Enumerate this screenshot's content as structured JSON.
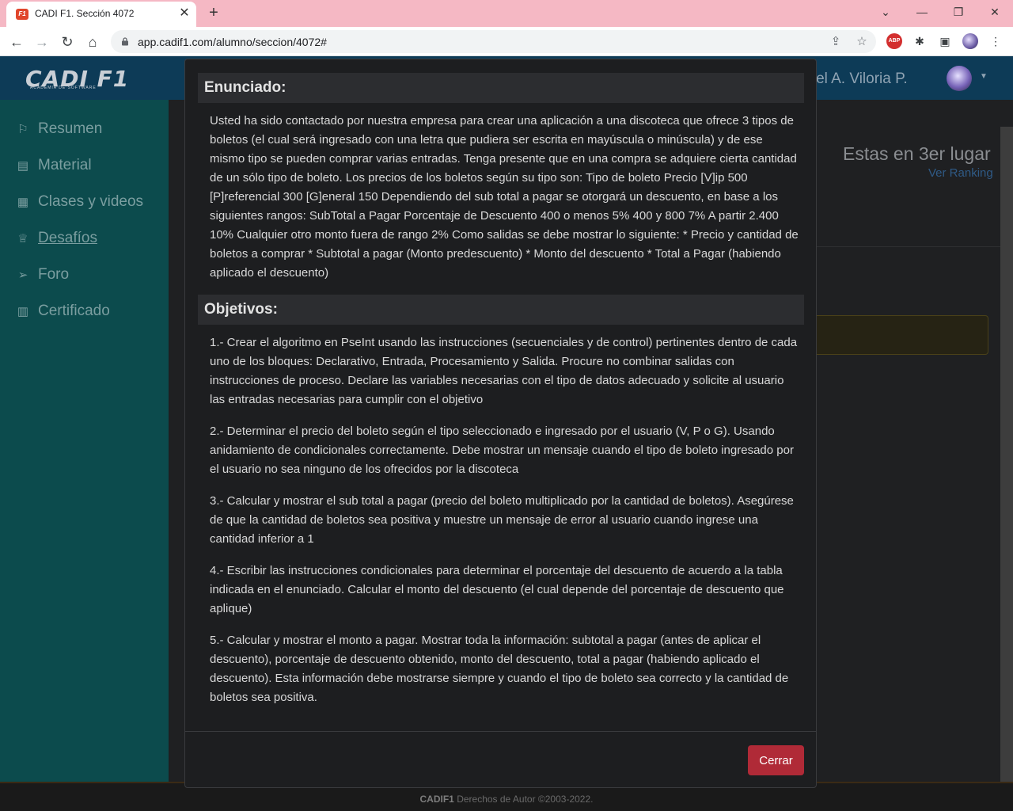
{
  "browser": {
    "tab_title": "CADI F1. Sección 4072",
    "tab_favicon_text": "F1",
    "url": "app.cadif1.com/alumno/seccion/4072#",
    "abp_label": "ABP"
  },
  "header": {
    "logo_text": "CADI F1",
    "logo_subtitle": "ACADEMIA DE SOFTWARE",
    "user_name": "briel A. Viloria P."
  },
  "sidebar": {
    "items": [
      {
        "label": "Resumen",
        "icon": "flag-icon"
      },
      {
        "label": "Material",
        "icon": "book-icon"
      },
      {
        "label": "Clases y videos",
        "icon": "calendar-icon"
      },
      {
        "label": "Desafíos",
        "icon": "trophy-icon"
      },
      {
        "label": "Foro",
        "icon": "send-icon"
      },
      {
        "label": "Certificado",
        "icon": "certificate-icon"
      }
    ]
  },
  "content": {
    "rank_text": "Estas en 3er lugar",
    "rank_link": "Ver Ranking"
  },
  "footer": {
    "brand": "CADIF1",
    "text": "Derechos de Autor ©2003-2022."
  },
  "modal": {
    "statement_heading": "Enunciado:",
    "statement": "Usted ha sido contactado por nuestra empresa para crear una aplicación a una discoteca que ofrece 3 tipos de boletos (el cual será ingresado con una letra que pudiera ser escrita en mayúscula o minúscula) y de ese mismo tipo se pueden comprar varias entradas. Tenga presente que en una compra se adquiere cierta cantidad de un sólo tipo de boleto. Los precios de los boletos según su tipo son: Tipo de boleto Precio [V]ip 500 [P]referencial 300 [G]eneral 150 Dependiendo del sub total a pagar se otorgará un descuento, en base a los siguientes rangos: SubTotal a Pagar Porcentaje de Descuento 400 o menos 5% 400 y 800 7% A partir 2.400 10% Cualquier otro monto fuera de rango 2% Como salidas se debe mostrar lo siguiente: * Precio y cantidad de boletos a comprar * Subtotal a pagar (Monto predescuento) * Monto del descuento * Total a Pagar (habiendo aplicado el descuento)",
    "objectives_heading": "Objetivos:",
    "objectives": [
      "1.- Crear el algoritmo en PseInt usando las instrucciones (secuenciales y de control) pertinentes dentro de cada uno de los bloques: Declarativo, Entrada, Procesamiento y Salida. Procure no combinar salidas con instrucciones de proceso. Declare las variables necesarias con el tipo de datos adecuado y solicite al usuario las entradas necesarias para cumplir con el objetivo",
      "2.- Determinar el precio del boleto según el tipo seleccionado e ingresado por el usuario (V, P o G). Usando anidamiento de condicionales correctamente. Debe mostrar un mensaje cuando el tipo de boleto ingresado por el usuario no sea ninguno de los ofrecidos por la discoteca",
      "3.- Calcular y mostrar el sub total a pagar (precio del boleto multiplicado por la cantidad de boletos). Asegúrese de que la cantidad de boletos sea positiva y muestre un mensaje de error al usuario cuando ingrese una cantidad inferior a 1",
      "4.- Escribir las instrucciones condicionales para determinar el porcentaje del descuento de acuerdo a la tabla indicada en el enunciado. Calcular el monto del descuento (el cual depende del porcentaje de descuento que aplique)",
      "5.- Calcular y mostrar el monto a pagar. Mostrar toda la información: subtotal a pagar (antes de aplicar el descuento), porcentaje de descuento obtenido, monto del descuento, total a pagar (habiendo aplicado el descuento). Esta información debe mostrarse siempre y cuando el tipo de boleto sea correcto y la cantidad de boletos sea positiva."
    ],
    "close_label": "Cerrar"
  }
}
